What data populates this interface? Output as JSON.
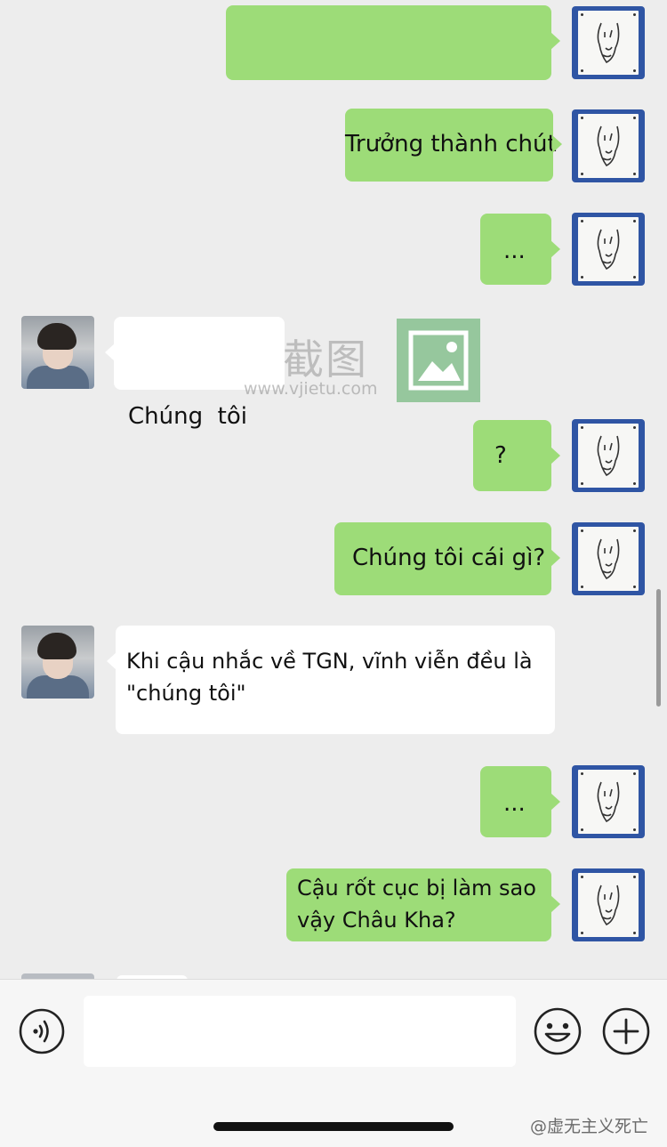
{
  "messages": [
    {
      "side": "me",
      "text": ""
    },
    {
      "side": "me",
      "text": "Trưởng thành chút"
    },
    {
      "side": "me",
      "text": "..."
    },
    {
      "side": "other",
      "text": "Chúng  tôi"
    },
    {
      "side": "me",
      "text": "?"
    },
    {
      "side": "me",
      "text": "Chúng tôi cái gì?"
    },
    {
      "side": "other",
      "line1": "Khi cậu nhắc về TGN, vĩnh viễn đều là",
      "line2": "\"chúng tôi\""
    },
    {
      "side": "me",
      "text": "..."
    },
    {
      "side": "me",
      "line1": "Cậu rốt cục bị làm sao",
      "line2": "vậy Châu Kha?"
    }
  ],
  "watermark": {
    "text": "截图",
    "url": "www.vjietu.com"
  },
  "input_bar": {
    "placeholder": ""
  },
  "credit": "@虚无主义死亡"
}
